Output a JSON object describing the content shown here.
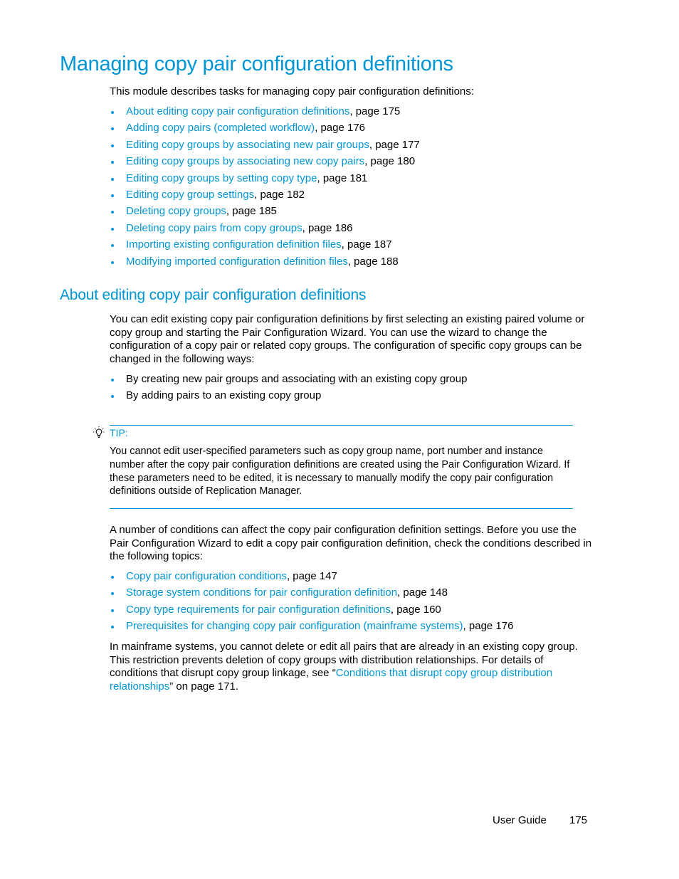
{
  "page": {
    "title": "Managing copy pair configuration definitions",
    "intro": "This module describes tasks for managing copy pair configuration definitions:",
    "toc": [
      {
        "link": "About editing copy pair configuration definitions",
        "suffix": ", page 175"
      },
      {
        "link": "Adding copy pairs (completed workflow)",
        "suffix": ", page 176"
      },
      {
        "link": "Editing copy groups by associating new pair groups",
        "suffix": ", page 177"
      },
      {
        "link": "Editing copy groups by associating new copy pairs",
        "suffix": ", page 180"
      },
      {
        "link": "Editing copy groups by setting copy type",
        "suffix": ", page 181"
      },
      {
        "link": "Editing copy group settings",
        "suffix": ", page 182"
      },
      {
        "link": "Deleting copy groups",
        "suffix": ", page 185"
      },
      {
        "link": "Deleting copy pairs from copy groups",
        "suffix": ", page 186"
      },
      {
        "link": "Importing existing configuration definition files",
        "suffix": ", page 187"
      },
      {
        "link": "Modifying imported configuration definition files",
        "suffix": ", page 188"
      }
    ]
  },
  "section": {
    "heading": "About editing copy pair configuration definitions",
    "para1": "You can edit existing copy pair configuration definitions by first selecting an existing paired volume or copy group and starting the Pair Configuration Wizard. You can use the wizard to change the configuration of a copy pair or related copy groups. The configuration of specific copy groups can be changed in the following ways:",
    "ways": [
      "By creating new pair groups and associating with an existing copy group",
      "By adding pairs to an existing copy group"
    ],
    "tip": {
      "icon": "lightbulb-icon",
      "label": "TIP:",
      "text": "You cannot edit user-specified parameters such as copy group name, port number and instance number after the copy pair configuration definitions are created using the Pair Configuration Wizard. If these parameters need to be edited, it is necessary to manually modify the copy pair configuration definitions outside of Replication Manager."
    },
    "para2": "A number of conditions can affect the copy pair configuration definition settings. Before you use the Pair Configuration Wizard to edit a copy pair configuration definition, check the conditions described in the following topics:",
    "topics": [
      {
        "link": "Copy pair configuration conditions",
        "suffix": ", page 147"
      },
      {
        "link": "Storage system conditions for pair configuration definition",
        "suffix": ", page 148"
      },
      {
        "link": "Copy type requirements for pair configuration definitions",
        "suffix": ", page 160"
      },
      {
        "link": "Prerequisites for changing copy pair configuration (mainframe systems)",
        "suffix": ", page 176"
      }
    ],
    "para3": {
      "before": "In mainframe systems, you cannot delete or edit all pairs that are already in an existing copy group. This restriction prevents deletion of copy groups with distribution relationships. For details of conditions that disrupt copy group linkage, see “",
      "link": "Conditions that disrupt copy group distribution relationships",
      "after": "” on page 171."
    }
  },
  "footer": {
    "label": "User Guide",
    "page_number": "175"
  },
  "colors": {
    "accent": "#0096d6",
    "text": "#000000"
  }
}
